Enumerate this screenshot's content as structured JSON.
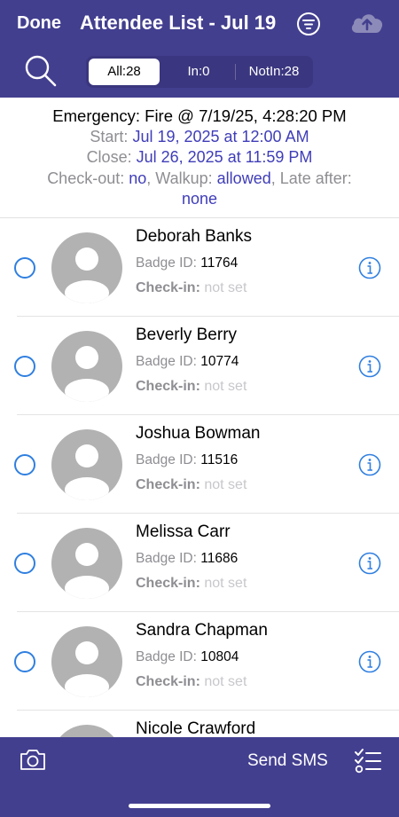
{
  "header": {
    "done_label": "Done",
    "title": "Attendee List - Jul 19",
    "icons": [
      "filter-icon",
      "cloud-upload-icon",
      "search-icon"
    ]
  },
  "segments": [
    {
      "label": "All:28",
      "selected": true
    },
    {
      "label": "In:0",
      "selected": false
    },
    {
      "label": "NotIn:28",
      "selected": false
    }
  ],
  "event": {
    "title": "Emergency: Fire @ 7/19/25, 4:28:20 PM",
    "start_label": "Start:",
    "start_value": "Jul 19, 2025 at 12:00 AM",
    "close_label": "Close:",
    "close_value": "Jul 26, 2025 at 11:59 PM",
    "checkout_label": "Check-out:",
    "checkout_value": "no",
    "walkup_label": "Walkup:",
    "walkup_value": "allowed",
    "late_label": "Late after:",
    "late_value": "none"
  },
  "list_labels": {
    "badge_label": "Badge ID:",
    "checkin_label": "Check-in:",
    "checkin_empty": "not set"
  },
  "attendees": [
    {
      "name": "Deborah Banks",
      "badge": "11764",
      "checkin": "not set"
    },
    {
      "name": "Beverly Berry",
      "badge": "10774",
      "checkin": "not set"
    },
    {
      "name": "Joshua Bowman",
      "badge": "11516",
      "checkin": "not set"
    },
    {
      "name": "Melissa Carr",
      "badge": "11686",
      "checkin": "not set"
    },
    {
      "name": "Sandra Chapman",
      "badge": "10804",
      "checkin": "not set"
    },
    {
      "name": "Nicole Crawford",
      "badge": "",
      "checkin": ""
    }
  ],
  "bottom": {
    "send_sms_label": "Send SMS",
    "icons": [
      "camera-icon",
      "checklist-icon"
    ]
  },
  "colors": {
    "bar": "#433f8f",
    "link_blue": "#3f3db8",
    "accent_blue": "#2f7fe0",
    "avatar_gray": "#b2b2b2"
  }
}
